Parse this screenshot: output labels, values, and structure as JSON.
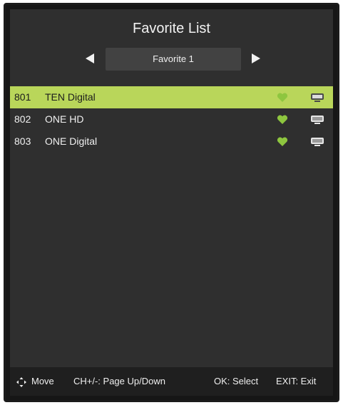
{
  "title": "Favorite List",
  "group": {
    "current": "Favorite 1",
    "prev_icon": "arrow-left-icon",
    "next_icon": "arrow-right-icon"
  },
  "channels": [
    {
      "number": "801",
      "name": "TEN Digital",
      "favorite_icon": "heart-icon",
      "type_icon": "tv-icon",
      "selected": true
    },
    {
      "number": "802",
      "name": "ONE HD",
      "favorite_icon": "heart-icon",
      "type_icon": "tv-icon",
      "selected": false
    },
    {
      "number": "803",
      "name": "ONE Digital",
      "favorite_icon": "heart-icon",
      "type_icon": "tv-icon",
      "selected": false
    }
  ],
  "footer": {
    "move_icon": "move-arrows-icon",
    "move": "Move",
    "page": "CH+/-: Page Up/Down",
    "select": "OK: Select",
    "exit": "EXIT: Exit"
  },
  "colors": {
    "highlight": "#b9d65a",
    "heart": "#8bc34a",
    "panel": "#2f2f2f",
    "footer": "#1f1f1f"
  }
}
